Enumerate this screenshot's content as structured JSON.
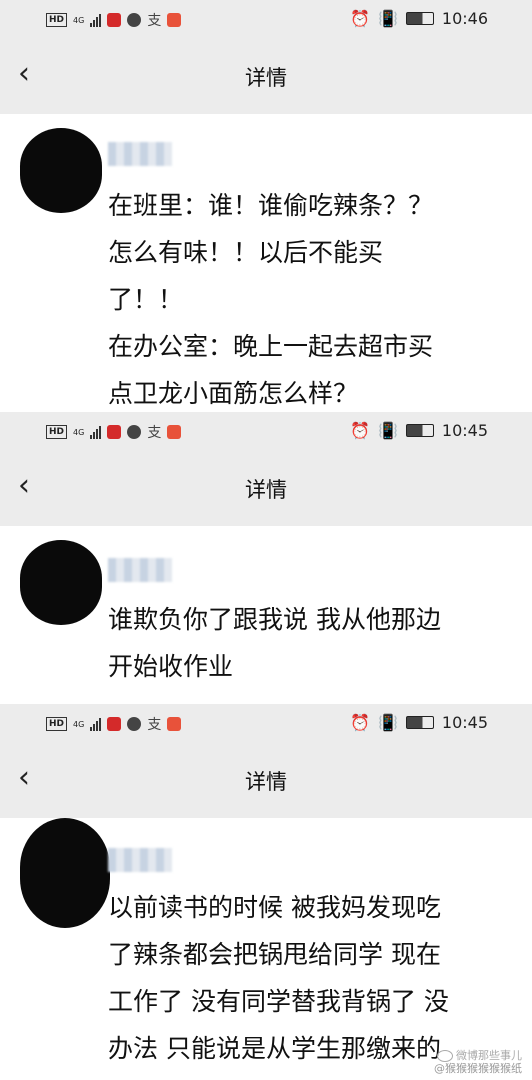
{
  "panels": [
    {
      "status": {
        "network": "4G",
        "time": "10:46"
      },
      "nav": {
        "back_icon": "chevron-left-icon",
        "title": "详情"
      },
      "lines": [
        "在班里：谁！谁偷吃辣条？？",
        "怎么有味！！以后不能买",
        "了！！",
        "在办公室：晚上一起去超市买",
        "点卫龙小面筋怎么样？"
      ]
    },
    {
      "status": {
        "network": "4G",
        "time": "10:45"
      },
      "nav": {
        "back_icon": "chevron-left-icon",
        "title": "详情"
      },
      "lines": [
        "谁欺负你了跟我说 我从他那边",
        "开始收作业"
      ]
    },
    {
      "status": {
        "network": "4G",
        "time": "10:45"
      },
      "nav": {
        "back_icon": "chevron-left-icon",
        "title": "详情"
      },
      "lines": [
        "以前读书的时候 被我妈发现吃",
        "了辣条都会把锅甩给同学  现在",
        "工作了 没有同学替我背锅了  没",
        "办法  只能说是从学生那缴来的"
      ]
    }
  ],
  "watermark": {
    "line1": "微博那些事儿",
    "line2": "@猴猴猴猴猴猴纸"
  },
  "colors": {
    "chrome": "#ececec",
    "text": "#111111"
  }
}
